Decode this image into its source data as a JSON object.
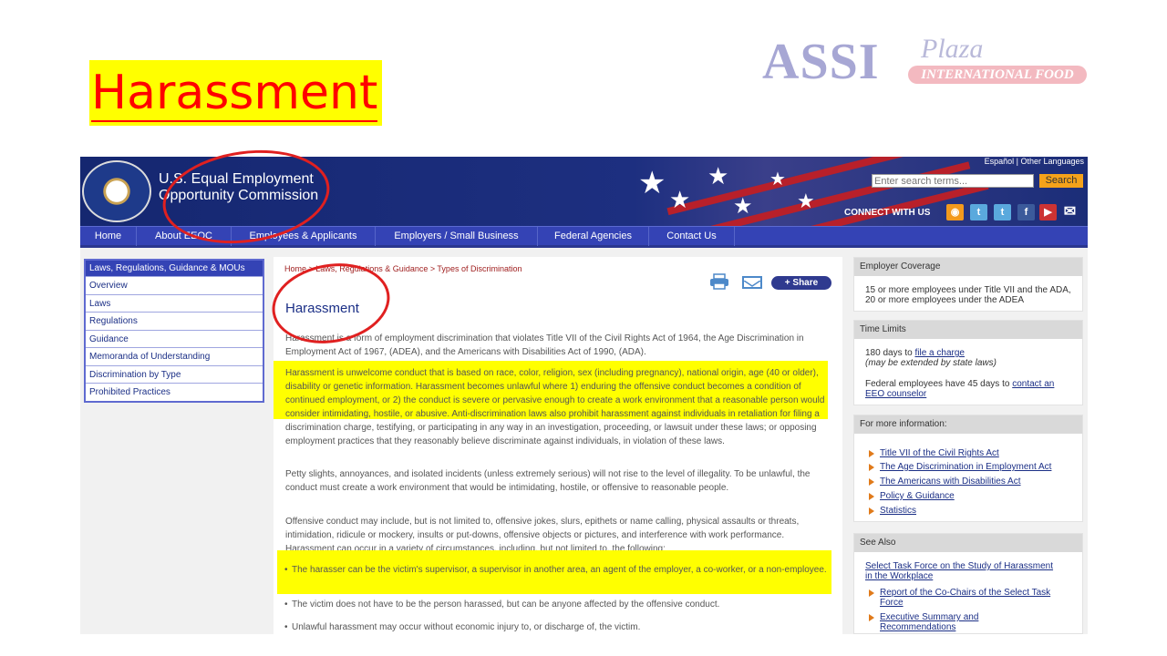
{
  "slide": {
    "title": "Harassment",
    "logo": {
      "main": "ASSI",
      "script": "Plaza",
      "band": "INTERNATIONAL FOOD"
    }
  },
  "site": {
    "agency_name_line1": "U.S. Equal Employment",
    "agency_name_line2": "Opportunity Commission",
    "lang_links": "Español | Other Languages",
    "search": {
      "placeholder": "Enter search terms...",
      "button": "Search"
    },
    "connect_label": "CONNECT WITH US",
    "social_icons": [
      "rss-icon",
      "twitter-icon",
      "twitter-icon",
      "facebook-icon",
      "youtube-icon",
      "email-icon"
    ]
  },
  "nav": {
    "items": [
      {
        "label": "Home"
      },
      {
        "label": "About EEOC"
      },
      {
        "label": "Employees & Applicants"
      },
      {
        "label": "Employers / Small Business"
      },
      {
        "label": "Federal Agencies"
      },
      {
        "label": "Contact Us"
      }
    ]
  },
  "sidebar": {
    "heading": "Laws, Regulations, Guidance & MOUs",
    "items": [
      {
        "label": "Overview"
      },
      {
        "label": "Laws"
      },
      {
        "label": "Regulations"
      },
      {
        "label": "Guidance"
      },
      {
        "label": "Memoranda of Understanding"
      },
      {
        "label": "Discrimination by Type"
      },
      {
        "label": "Prohibited Practices"
      }
    ]
  },
  "content": {
    "breadcrumb": "Home > Laws, Regulations & Guidance > Types of Discrimination",
    "share_label": "+ Share",
    "heading": "Harassment",
    "p1": "Harassment is a form of employment discrimination that violates Title VII of the Civil Rights Act of 1964, the Age Discrimination in Employment Act of 1967, (ADEA), and the Americans with Disabilities Act of 1990, (ADA).",
    "p2_highlight": "Harassment is unwelcome conduct that is based on race, color, religion, sex (including pregnancy), national origin, age (40 or older), disability or genetic information. Harassment becomes unlawful where 1) enduring the offensive conduct becomes a condition of continued employment, or 2) the conduct is severe or pervasive enough to create a work environment that a reasonable person would consider intimidating, hostile, or abusive.",
    "p2_rest": " Anti-discrimination laws also prohibit harassment against individuals in retaliation for filing a discrimination charge, testifying, or participating in any way in an investigation, proceeding, or lawsuit under these laws; or opposing employment practices that they reasonably believe discriminate against individuals, in violation of these laws.",
    "p3": "Petty slights, annoyances, and isolated incidents (unless extremely serious) will not rise to the level of illegality. To be unlawful, the conduct must create a work environment that would be intimidating, hostile, or offensive to reasonable people.",
    "p4": "Offensive conduct may include, but is not limited to, offensive jokes, slurs, epithets or name calling, physical assaults or threats, intimidation, ridicule or mockery, insults or put-downs, offensive objects or pictures, and interference with work performance. Harassment can occur in a variety of circumstances, including, but not limited to, the following:",
    "bullets": [
      "The harasser can be the victim's supervisor, a supervisor in another area, an agent of the employer, a co-worker, or a non-employee.",
      "The victim does not have to be the person harassed, but can be anyone affected by the offensive conduct.",
      "Unlawful harassment may occur without economic injury to, or discharge of, the victim."
    ]
  },
  "right": {
    "coverage": {
      "heading": "Employer Coverage",
      "text": "15 or more employees under Title VII and the ADA, 20 or more employees under the ADEA"
    },
    "time_limits": {
      "heading": "Time Limits",
      "line1_prefix": "180 days to ",
      "line1_link": "file a charge",
      "line2": "(may be extended by state laws)",
      "line3_prefix": "Federal employees have 45 days to ",
      "line3_link1": "contact an",
      "line3_link2": "EEO counselor"
    },
    "more_info": {
      "heading": "For more information:",
      "links": [
        "Title VII of the Civil Rights Act",
        "The Age Discrimination in Employment Act",
        "The Americans with Disabilities Act",
        "Policy & Guidance",
        "Statistics"
      ]
    },
    "see_also": {
      "heading": "See Also",
      "link1_line1": "Select Task Force on the Study of Harassment",
      "link1_line2": "in the Workplace",
      "link2_line1": "Report of the Co-Chairs of the Select Task",
      "link2_line2": "Force",
      "link3_line1": "Executive Summary and",
      "link3_line2": "Recommendations"
    }
  },
  "colors": {
    "title_highlight": "#ffff00",
    "title_text": "#ff0000",
    "header_blue": "#1d2f80",
    "nav_blue": "#3443b5",
    "annotation_red": "#e02020"
  }
}
